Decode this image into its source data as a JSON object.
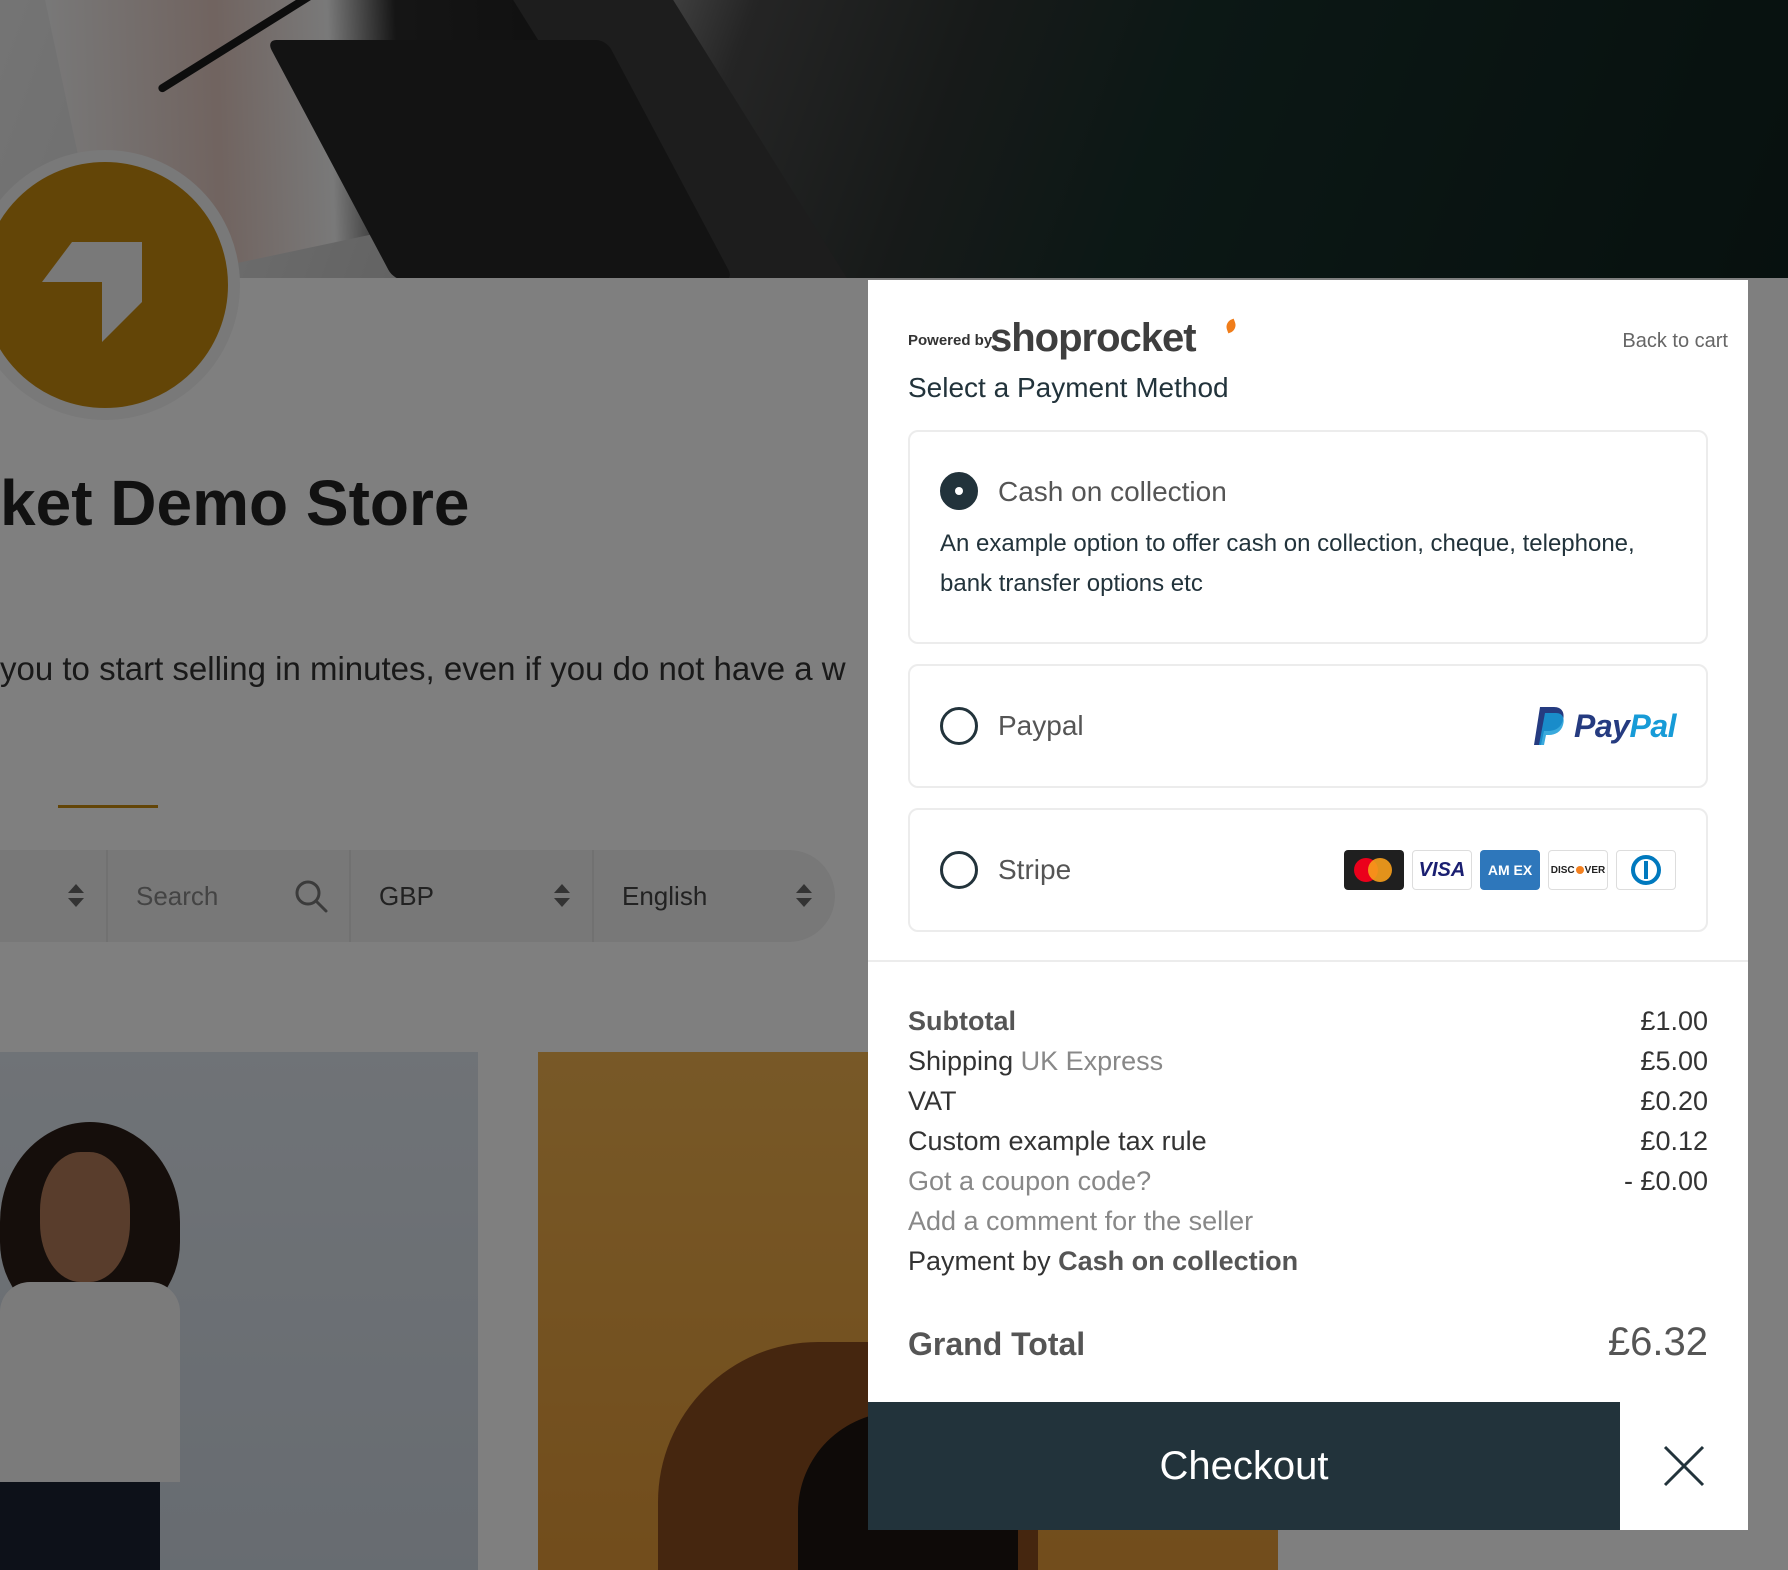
{
  "store": {
    "title": "ket Demo Store",
    "tagline": "you to start selling in minutes, even if you do not have a w",
    "filters": {
      "search_placeholder": "Search",
      "currency": "GBP",
      "language": "English"
    }
  },
  "modal": {
    "powered_by": "Powered by",
    "brand": "shoprocket",
    "back_to_cart": "Back to cart",
    "section_title": "Select a Payment Method",
    "payment_methods": [
      {
        "label": "Cash on collection",
        "description": "An example option to offer cash on collection, cheque, telephone, bank transfer options etc",
        "selected": true
      },
      {
        "label": "Paypal",
        "logo_text_1": "Pay",
        "logo_text_2": "Pal",
        "selected": false
      },
      {
        "label": "Stripe",
        "cards": [
          "mastercard-icon",
          "visa-icon",
          "amex-icon",
          "discover-icon",
          "diners-icon"
        ],
        "card_text": {
          "visa": "VISA",
          "amex": "AM EX",
          "discover_1": "DISC",
          "discover_2": "VER"
        },
        "selected": false
      }
    ],
    "summary": {
      "subtotal_label": "Subtotal",
      "subtotal_value": "£1.00",
      "shipping_label": "Shipping",
      "shipping_method": "UK Express",
      "shipping_value": "£5.00",
      "vat_label": "VAT",
      "vat_value": "£0.20",
      "custom_tax_label": "Custom example tax rule",
      "custom_tax_value": "£0.12",
      "coupon_label": "Got a coupon code?",
      "coupon_value": "- £0.00",
      "comment_label": "Add a comment for the seller",
      "payment_by_label": "Payment by",
      "payment_by_value": "Cash on collection",
      "grand_total_label": "Grand Total",
      "grand_total_value": "£6.32"
    },
    "checkout_label": "Checkout"
  },
  "colors": {
    "accent_dark": "#22333b",
    "brand_gold": "#c78b0e",
    "paypal_blue": "#253b80",
    "paypal_light": "#179bd7"
  }
}
